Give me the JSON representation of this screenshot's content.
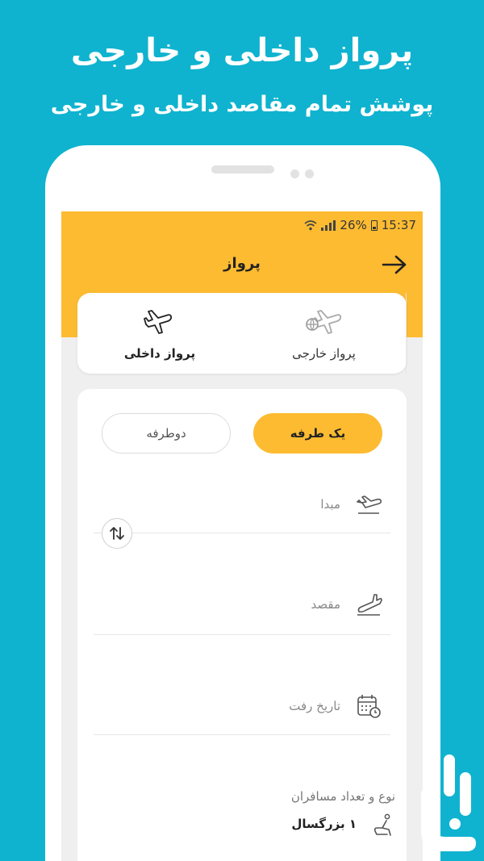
{
  "promo": {
    "headline": "پرواز داخلی و خارجی",
    "subline": "پوشش تمام مقاصد داخلی و خارجی"
  },
  "status_bar": {
    "battery": "26%",
    "time": "15:37"
  },
  "app_bar": {
    "title": "پرواز",
    "back_icon": "arrow-right-icon"
  },
  "flight_type_tabs": [
    {
      "label": "پرواز داخلی",
      "icon": "airplane-icon",
      "active": true
    },
    {
      "label": "پرواز خارجی",
      "icon": "international-airplane-icon",
      "active": false
    }
  ],
  "trip_type": {
    "one_way": "یک طرفه",
    "round_trip": "دوطرفه",
    "selected": "one_way"
  },
  "form": {
    "origin_label": "مبدا",
    "destination_label": "مقصد",
    "departure_date_label": "تاریخ رفت",
    "passengers_title": "نوع و تعداد مسافران",
    "passengers_value": "۱ بزرگسال"
  },
  "colors": {
    "background": "#0fb3cf",
    "accent": "#fdbb31",
    "card": "#ffffff"
  }
}
